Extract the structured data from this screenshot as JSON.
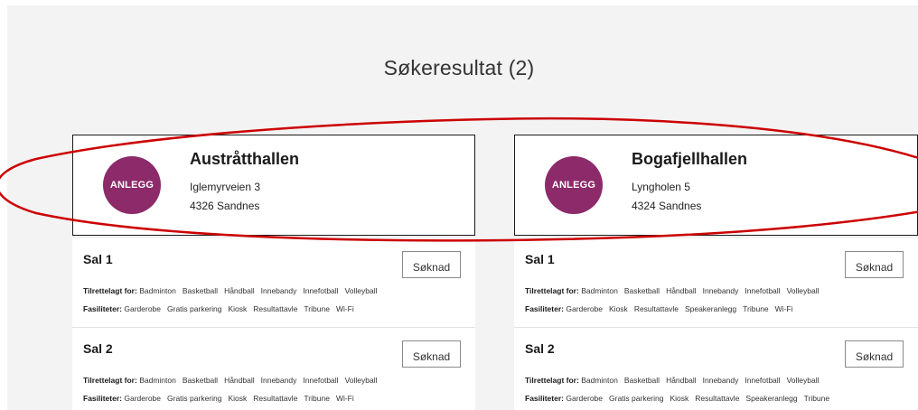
{
  "results": {
    "heading": "Søkeresultat (2)"
  },
  "labels": {
    "suitable_for": "Tilrettelagt for:",
    "facilities": "Fasiliteter:",
    "apply": "Søknad"
  },
  "colors": {
    "badge": "#8c2a6a",
    "annotation": "#cc0000"
  },
  "facilities": [
    {
      "badge": "ANLEGG",
      "name": "Austråtthallen",
      "street": "Iglemyrveien 3",
      "city": "4326 Sandnes",
      "halls": [
        {
          "name": "Sal 1",
          "suitable_for": [
            "Badminton",
            "Basketball",
            "Håndball",
            "Innebandy",
            "Innefotball",
            "Volleyball"
          ],
          "facilities": [
            "Garderobe",
            "Gratis parkering",
            "Kiosk",
            "Resultattavle",
            "Tribune",
            "Wi-Fi"
          ]
        },
        {
          "name": "Sal 2",
          "suitable_for": [
            "Badminton",
            "Basketball",
            "Håndball",
            "Innebandy",
            "Innefotball",
            "Volleyball"
          ],
          "facilities": [
            "Garderobe",
            "Gratis parkering",
            "Kiosk",
            "Resultattavle",
            "Tribune",
            "Wi-Fi"
          ]
        }
      ]
    },
    {
      "badge": "ANLEGG",
      "name": "Bogafjellhallen",
      "street": "Lyngholen 5",
      "city": "4324 Sandnes",
      "halls": [
        {
          "name": "Sal 1",
          "suitable_for": [
            "Badminton",
            "Basketball",
            "Håndball",
            "Innebandy",
            "Innefotball",
            "Volleyball"
          ],
          "facilities": [
            "Garderobe",
            "Kiosk",
            "Resultattavle",
            "Speakeranlegg",
            "Tribune",
            "Wi-Fi"
          ]
        },
        {
          "name": "Sal 2",
          "suitable_for": [
            "Badminton",
            "Basketball",
            "Håndball",
            "Innebandy",
            "Innefotball",
            "Volleyball"
          ],
          "facilities": [
            "Garderobe",
            "Gratis parkering",
            "Kiosk",
            "Resultattavle",
            "Speakeranlegg",
            "Tribune"
          ]
        }
      ]
    }
  ]
}
